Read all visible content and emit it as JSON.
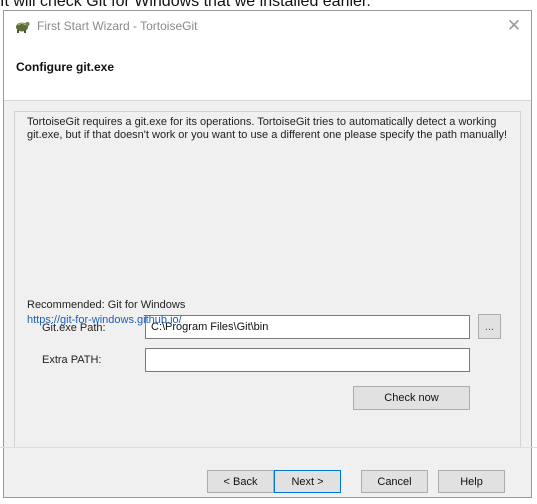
{
  "caption": "It will check Git for Windows that we installed earlier.",
  "window": {
    "title": "First Start Wizard - TortoiseGit",
    "close_glyph": "✕"
  },
  "header": {
    "title": "Configure git.exe"
  },
  "content": {
    "description": "TortoiseGit requires a git.exe for its operations. TortoiseGit tries to automatically detect a working git.exe, but if that doesn't work or you want to use a different one please specify the path manually!",
    "git_path": {
      "label": "Git.exe Path:",
      "value": "C:\\Program Files\\Git\\bin",
      "browse_label": "..."
    },
    "extra_path": {
      "label": "Extra PATH:",
      "value": ""
    },
    "check_now_label": "Check now",
    "recommended_label": "Recommended: Git for Windows",
    "recommended_link": "https://git-for-windows.github.io/"
  },
  "footer": {
    "back_label": "< Back",
    "next_label": "Next >",
    "cancel_label": "Cancel",
    "help_label": "Help"
  },
  "icons": {
    "app": "tortoisegit-app-icon",
    "close": "close-icon"
  }
}
